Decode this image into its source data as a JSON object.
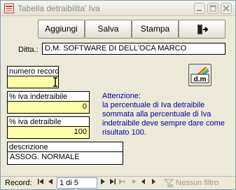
{
  "window": {
    "title": "Tabella detraibilita' Iva"
  },
  "toolbar": {
    "add_label": "Aggiungi",
    "save_label": "Salva",
    "print_label": "Stampa",
    "exit_icon": "door-exit-icon"
  },
  "form": {
    "ditta_label": "Ditta.:",
    "ditta_value": "D.M. SOFTWARE DI DELL'OCA MARCO",
    "numero_record_label": "numero record",
    "numero_record_value": "",
    "iva_indetraibile_label": "% iva indetraibile",
    "iva_indetraibile_value": "0",
    "iva_detraibile_label": "% iva detraibile",
    "iva_detraibile_value": "100",
    "descrizione_label": "descrizione",
    "descrizione_value": "ASSOG. NORMALE",
    "dm_button_label": "d.m",
    "note": "Attenzione:\nla percentuale di Iva detraibile sommata alla percentuale di Iva indetraibile deve sempre dare come risultato  100."
  },
  "statusbar": {
    "record_label": "Record:",
    "record_position": "1 di 5",
    "filter_label": "Nessun filtro"
  },
  "colors": {
    "window_bg": "#ECE9D8",
    "required_field_bg": "#FFFFA8",
    "note_text": "#0000A0"
  }
}
